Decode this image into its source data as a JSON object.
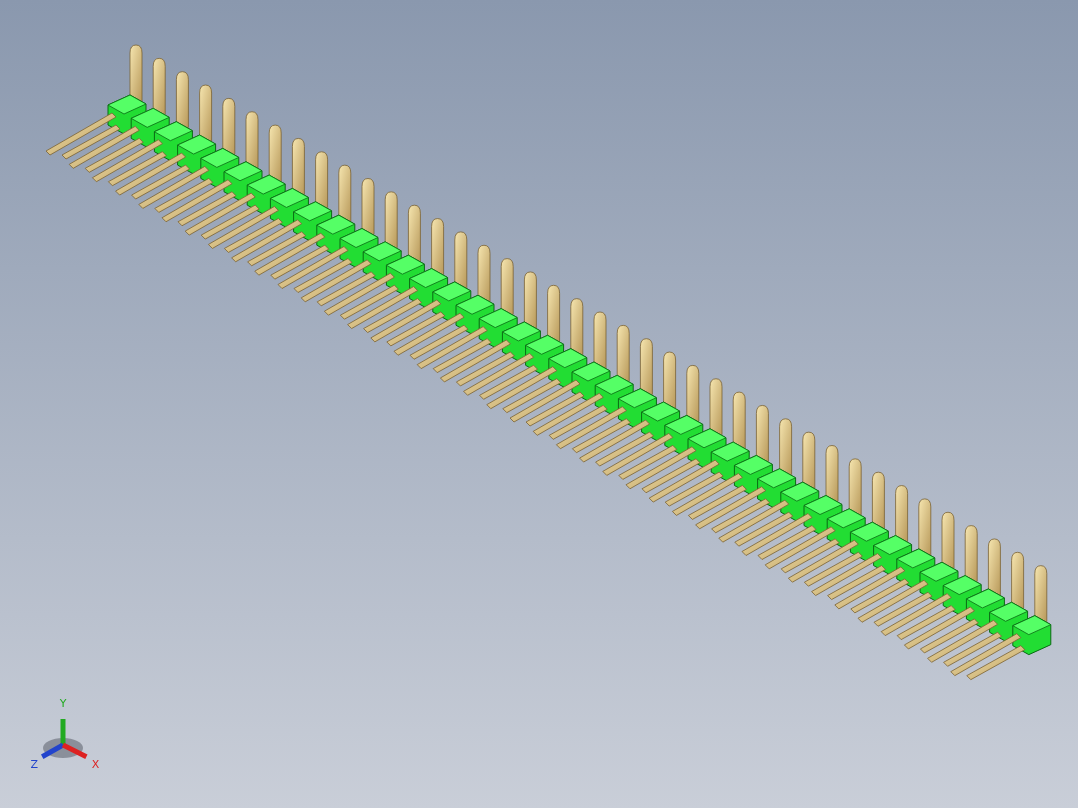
{
  "viewport": {
    "triad": {
      "axes": [
        {
          "label": "Y",
          "color": "#22aa22"
        },
        {
          "label": "Z",
          "color": "#2244cc"
        },
        {
          "label": "X",
          "color": "#dd2222"
        }
      ]
    }
  }
}
